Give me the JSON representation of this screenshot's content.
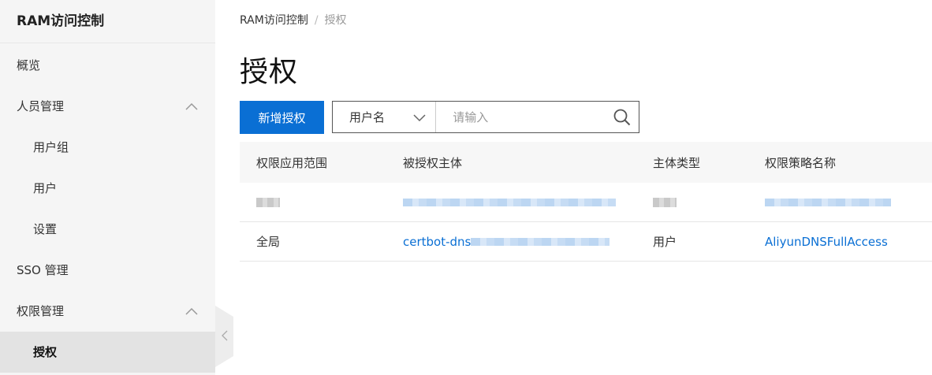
{
  "sidebar": {
    "title": "RAM访问控制",
    "items": [
      {
        "label": "概览"
      },
      {
        "label": "人员管理"
      },
      {
        "label": "用户组"
      },
      {
        "label": "用户"
      },
      {
        "label": "设置"
      },
      {
        "label": "SSO 管理"
      },
      {
        "label": "权限管理"
      },
      {
        "label": "授权"
      }
    ],
    "active": "授权"
  },
  "breadcrumb": {
    "root": "RAM访问控制",
    "separator": "/",
    "current": "授权"
  },
  "page": {
    "title": "授权"
  },
  "toolbar": {
    "add_button": "新增授权",
    "filter_select": "用户名",
    "search_placeholder": "请输入"
  },
  "table": {
    "columns": [
      "权限应用范围",
      "被授权主体",
      "主体类型",
      "权限策略名称"
    ],
    "rows": [
      {
        "scope": "",
        "principal": "",
        "type": "",
        "policy": ""
      },
      {
        "scope": "全局",
        "principal": "certbot-dns",
        "type": "用户",
        "policy": "AliyunDNSFullAccess"
      }
    ]
  },
  "colors": {
    "primary": "#0a6fd4",
    "sidebar_bg": "#f5f5f5",
    "active_bg": "#e3e3e3"
  }
}
